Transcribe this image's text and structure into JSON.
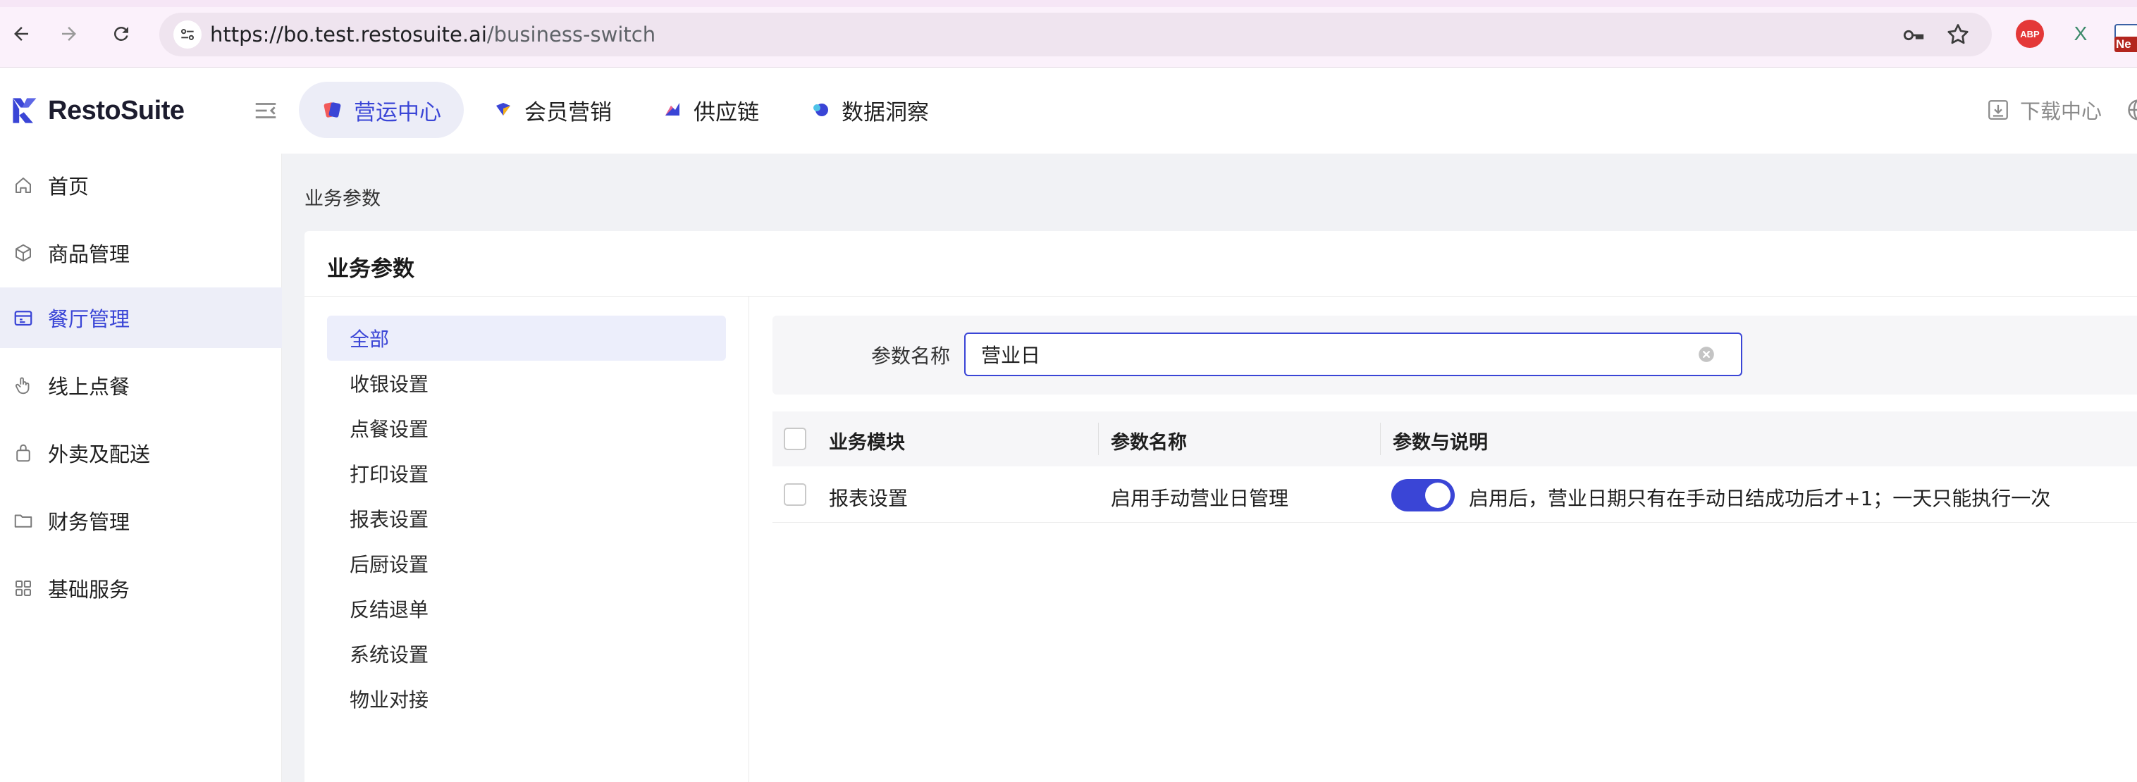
{
  "browser": {
    "url_host": "https://bo.test.restosuite.ai",
    "url_path": "/business-switch",
    "extensions": {
      "abp_label": "ABP",
      "x_label": "X",
      "new_badge": "Ne"
    }
  },
  "app": {
    "brand": "RestoSuite",
    "top_tabs": [
      {
        "label": "营运中心",
        "active": true
      },
      {
        "label": "会员营销",
        "active": false
      },
      {
        "label": "供应链",
        "active": false
      },
      {
        "label": "数据洞察",
        "active": false
      }
    ],
    "download_center": "下载中心"
  },
  "sidebar": {
    "items": [
      {
        "label": "首页",
        "icon": "home-icon",
        "active": false
      },
      {
        "label": "商品管理",
        "icon": "box-icon",
        "active": false
      },
      {
        "label": "餐厅管理",
        "icon": "store-icon",
        "active": true
      },
      {
        "label": "线上点餐",
        "icon": "hand-pointer-icon",
        "active": false
      },
      {
        "label": "外卖及配送",
        "icon": "bag-icon",
        "active": false
      },
      {
        "label": "财务管理",
        "icon": "folder-icon",
        "active": false
      },
      {
        "label": "基础服务",
        "icon": "grid-icon",
        "active": false
      }
    ]
  },
  "page": {
    "breadcrumb": "业务参数",
    "card_title": "业务参数",
    "categories": [
      {
        "label": "全部",
        "active": true
      },
      {
        "label": "收银设置",
        "active": false
      },
      {
        "label": "点餐设置",
        "active": false
      },
      {
        "label": "打印设置",
        "active": false
      },
      {
        "label": "报表设置",
        "active": false
      },
      {
        "label": "后厨设置",
        "active": false
      },
      {
        "label": "反结退单",
        "active": false
      },
      {
        "label": "系统设置",
        "active": false
      },
      {
        "label": "物业对接",
        "active": false
      }
    ],
    "filter": {
      "label": "参数名称",
      "value": "营业日"
    },
    "table": {
      "columns": [
        "业务模块",
        "参数名称",
        "参数与说明"
      ],
      "rows": [
        {
          "module": "报表设置",
          "name": "启用手动营业日管理",
          "enabled": true,
          "description": "启用后，营业日期只有在手动日结成功后才+1；一天只能执行一次"
        }
      ]
    }
  },
  "colors": {
    "accent": "#3a45d6",
    "active_bg": "#ecedf7",
    "page_bg": "#f1f2f5"
  }
}
